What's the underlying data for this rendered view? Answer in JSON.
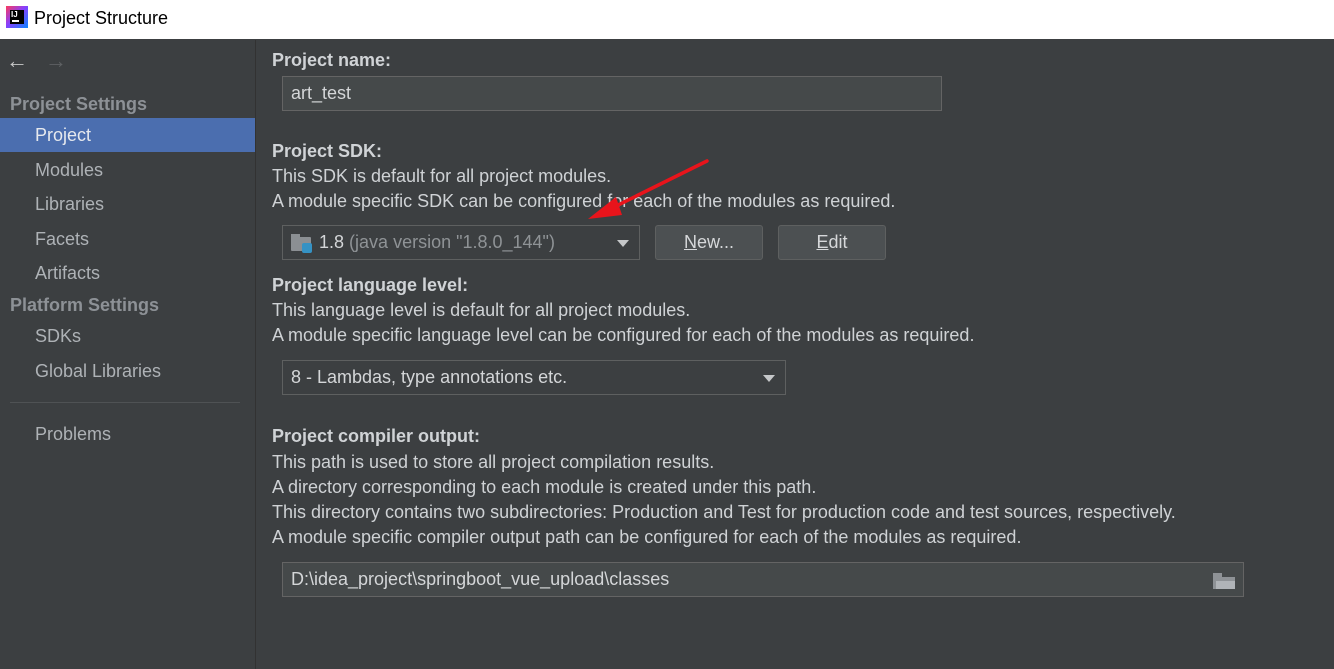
{
  "window": {
    "title": "Project Structure"
  },
  "nav": {
    "back": "←",
    "forward": "→"
  },
  "sidebar": {
    "project_settings_header": "Project Settings",
    "project_items": [
      {
        "label": "Project",
        "selected": true
      },
      {
        "label": "Modules"
      },
      {
        "label": "Libraries"
      },
      {
        "label": "Facets"
      },
      {
        "label": "Artifacts"
      }
    ],
    "platform_settings_header": "Platform Settings",
    "platform_items": [
      {
        "label": "SDKs"
      },
      {
        "label": "Global Libraries"
      }
    ],
    "problems": "Problems"
  },
  "main": {
    "project_name": {
      "label": "Project name:",
      "value": "art_test"
    },
    "project_sdk": {
      "label": "Project SDK:",
      "desc1": "This SDK is default for all project modules.",
      "desc2": "A module specific SDK can be configured for each of the modules as required.",
      "selected_version": "1.8",
      "selected_detail": "(java version \"1.8.0_144\")",
      "new_button": {
        "mnemonic": "N",
        "rest": "ew..."
      },
      "edit_button": {
        "mnemonic": "E",
        "rest": "dit"
      }
    },
    "language_level": {
      "label": "Project language level:",
      "desc1": "This language level is default for all project modules.",
      "desc2": "A module specific language level can be configured for each of the modules as required.",
      "selected": "8 - Lambdas, type annotations etc."
    },
    "compiler_output": {
      "label": "Project compiler output:",
      "desc1": "This path is used to store all project compilation results.",
      "desc2": "A directory corresponding to each module is created under this path.",
      "desc3": "This directory contains two subdirectories: Production and Test for production code and test sources, respectively.",
      "desc4": "A module specific compiler output path can be configured for each of the modules as required.",
      "path": "D:\\idea_project\\springboot_vue_upload\\classes"
    }
  },
  "colors": {
    "background": "#3c3f41",
    "selection": "#4b6eaf",
    "annotation_arrow": "#e8141b",
    "sdk_icon": "#3592c4"
  }
}
